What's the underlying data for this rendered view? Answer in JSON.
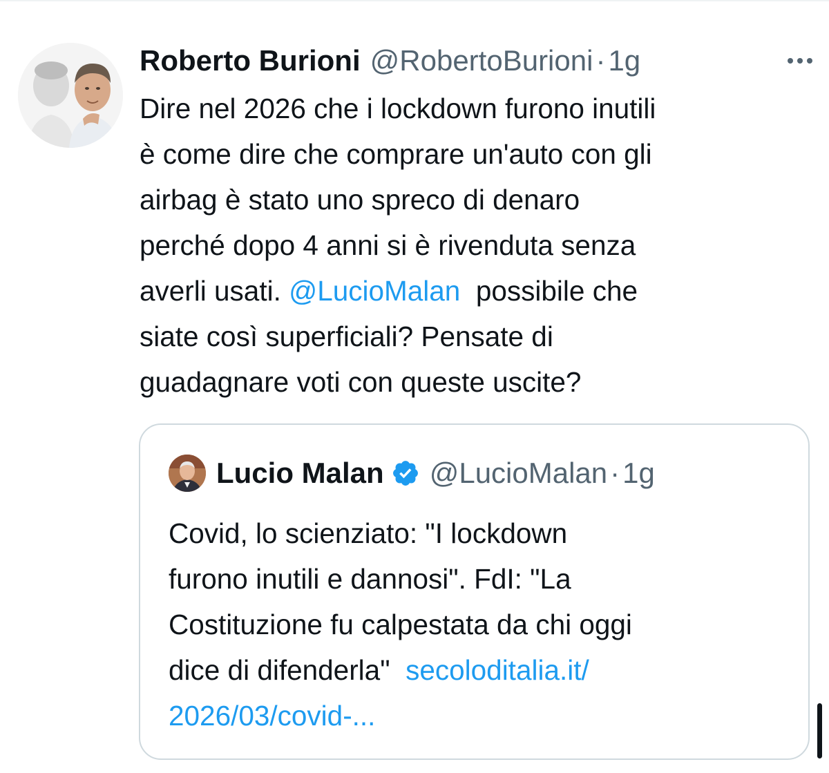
{
  "tweet": {
    "author_name": "Roberto Burioni",
    "author_handle": "@RobertoBurioni",
    "separator": "·",
    "time": "1g",
    "more_icon": "more-horizontal-icon",
    "lines": {
      "l1": "Dire nel 2026 che i lockdown furono inutili",
      "l2": "è come dire che comprare un'auto con gli",
      "l3": "airbag è stato uno spreco di denaro",
      "l4": "perché dopo 4 anni si è rivenduta senza",
      "l5_before": "averli usati. ",
      "l5_mention": "@LucioMalan",
      "l5_after": "  possibile che",
      "l6": "siate così superficiali? Pensate di",
      "l7": "guadagnare voti con queste uscite?"
    }
  },
  "quoted_tweet": {
    "author_name": "Lucio Malan",
    "verified_icon": "verified-badge-icon",
    "author_handle": "@LucioMalan",
    "separator": "·",
    "time": "1g",
    "lines": {
      "l1": "Covid, lo scienziato: \"I lockdown",
      "l2": "furono inutili e dannosi\". FdI: \"La",
      "l3": "Costituzione fu calpestata da chi oggi",
      "l4_text": "dice di difenderla\"  ",
      "l4_link": "secoloditalia.it/",
      "l5_link": "2026/03/covid-..."
    }
  },
  "colors": {
    "text": "#0f1419",
    "secondary": "#536471",
    "link": "#1d9bf0",
    "border": "#cfd9de",
    "verified": "#1d9bf0"
  }
}
